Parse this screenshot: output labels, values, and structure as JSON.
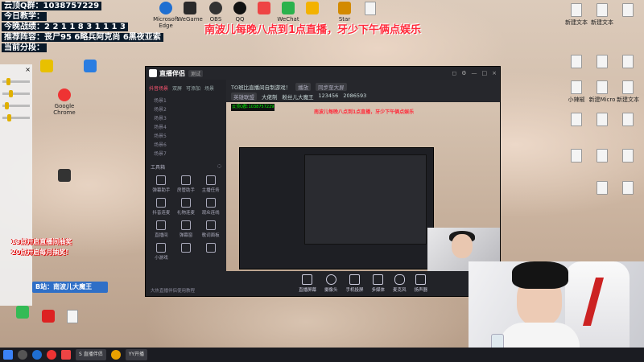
{
  "overlay": {
    "line1": "云顶Q群：1038757229",
    "line2": "今日教学：",
    "line3": "今晚战绩：2 2 1 1 8 3 1 1 1 3",
    "line4": "推荐阵容：丧尸95 6略兵阿克尚 6黑夜亚索",
    "line5": "当前分段：",
    "red_banner": "南波儿每晚八点到1点直播，牙少下午俩点娱乐"
  },
  "desktop_top_icons": [
    {
      "label": "Microsoft Edge",
      "color": "#1f6fd1"
    },
    {
      "label": "WeGame",
      "color": "#2a2a2a"
    },
    {
      "label": "OBS",
      "color": "#333"
    },
    {
      "label": "QQ",
      "color": "#111"
    },
    {
      "label": "",
      "color": "#e44"
    },
    {
      "label": "WeChat",
      "color": "#2bb24c"
    },
    {
      "label": "",
      "color": "#f3b200"
    },
    {
      "label": "Star",
      "color": "#d38a00"
    },
    {
      "label": "",
      "color": "#eeeeee"
    }
  ],
  "desktop_right_icons": [
    {
      "label": "新建文本"
    },
    {
      "label": "新建文本"
    },
    {
      "label": ""
    },
    {
      "label": ""
    },
    {
      "label": ""
    },
    {
      "label": ""
    },
    {
      "label": ""
    },
    {
      "label": ""
    },
    {
      "label": ""
    },
    {
      "label": "小辣椒"
    },
    {
      "label": "新建Micro"
    },
    {
      "label": "新建文本"
    },
    {
      "label": ""
    },
    {
      "label": ""
    },
    {
      "label": ""
    }
  ],
  "desktop_left_icons": [
    {
      "label": "",
      "color": "#e8c000"
    },
    {
      "label": "Google Chrome",
      "color": "#e33"
    },
    {
      "label": "",
      "color": "#2a7de1"
    },
    {
      "label": "",
      "color": "#aaa"
    },
    {
      "label": "",
      "color": "#333"
    },
    {
      "label": "",
      "color": "#333"
    }
  ],
  "left_panel": {
    "title": "",
    "close": "×"
  },
  "promos": {
    "p1": "13点开启直播间抽奖",
    "p2": "20点开启每月抽奖!"
  },
  "bili_tag": "B站：南波儿大魔王",
  "app": {
    "name": "直播伴侣",
    "version": "测试",
    "title_icons": [
      "◻",
      "⚙",
      "—",
      "□",
      "×"
    ],
    "side_tabs": [
      "抖音场景",
      "双屏",
      "可添加",
      "场景"
    ],
    "scenes": [
      "场景1",
      "场景2",
      "场景3",
      "场景4",
      "场景5",
      "场景6",
      "场景7"
    ],
    "tools_title": "工具箱",
    "tools": [
      "弹幕助手",
      "房管助手",
      "主播任务",
      "抖音连麦",
      "礼物连麦",
      "观众连线",
      "直播间",
      "弹幕窗",
      "歌词面板",
      "小游戏",
      "",
      ""
    ],
    "footer": "大热直播伴侣使用教程",
    "stream_title": "TO斑比直播间自制游戏！",
    "stream_btn1": "播放",
    "stream_btn2": "同步至大屏",
    "stream_row2": [
      "英雄联盟",
      "大佬制",
      "粉丝儿大魔王",
      "123456",
      "2086593"
    ],
    "toolbar": [
      "直播屏幕",
      "摄像头",
      "手机投屏",
      "多媒体",
      "麦克风",
      "扬声器"
    ]
  },
  "inner_preview": {
    "red_text": "南波儿每晚八点到1点直播，牙少下午俩点娱乐",
    "green_text": "云顶Q群:1038757229"
  },
  "taskbar": {
    "apps": [
      "S 直播伴侣",
      "YY开播"
    ]
  }
}
